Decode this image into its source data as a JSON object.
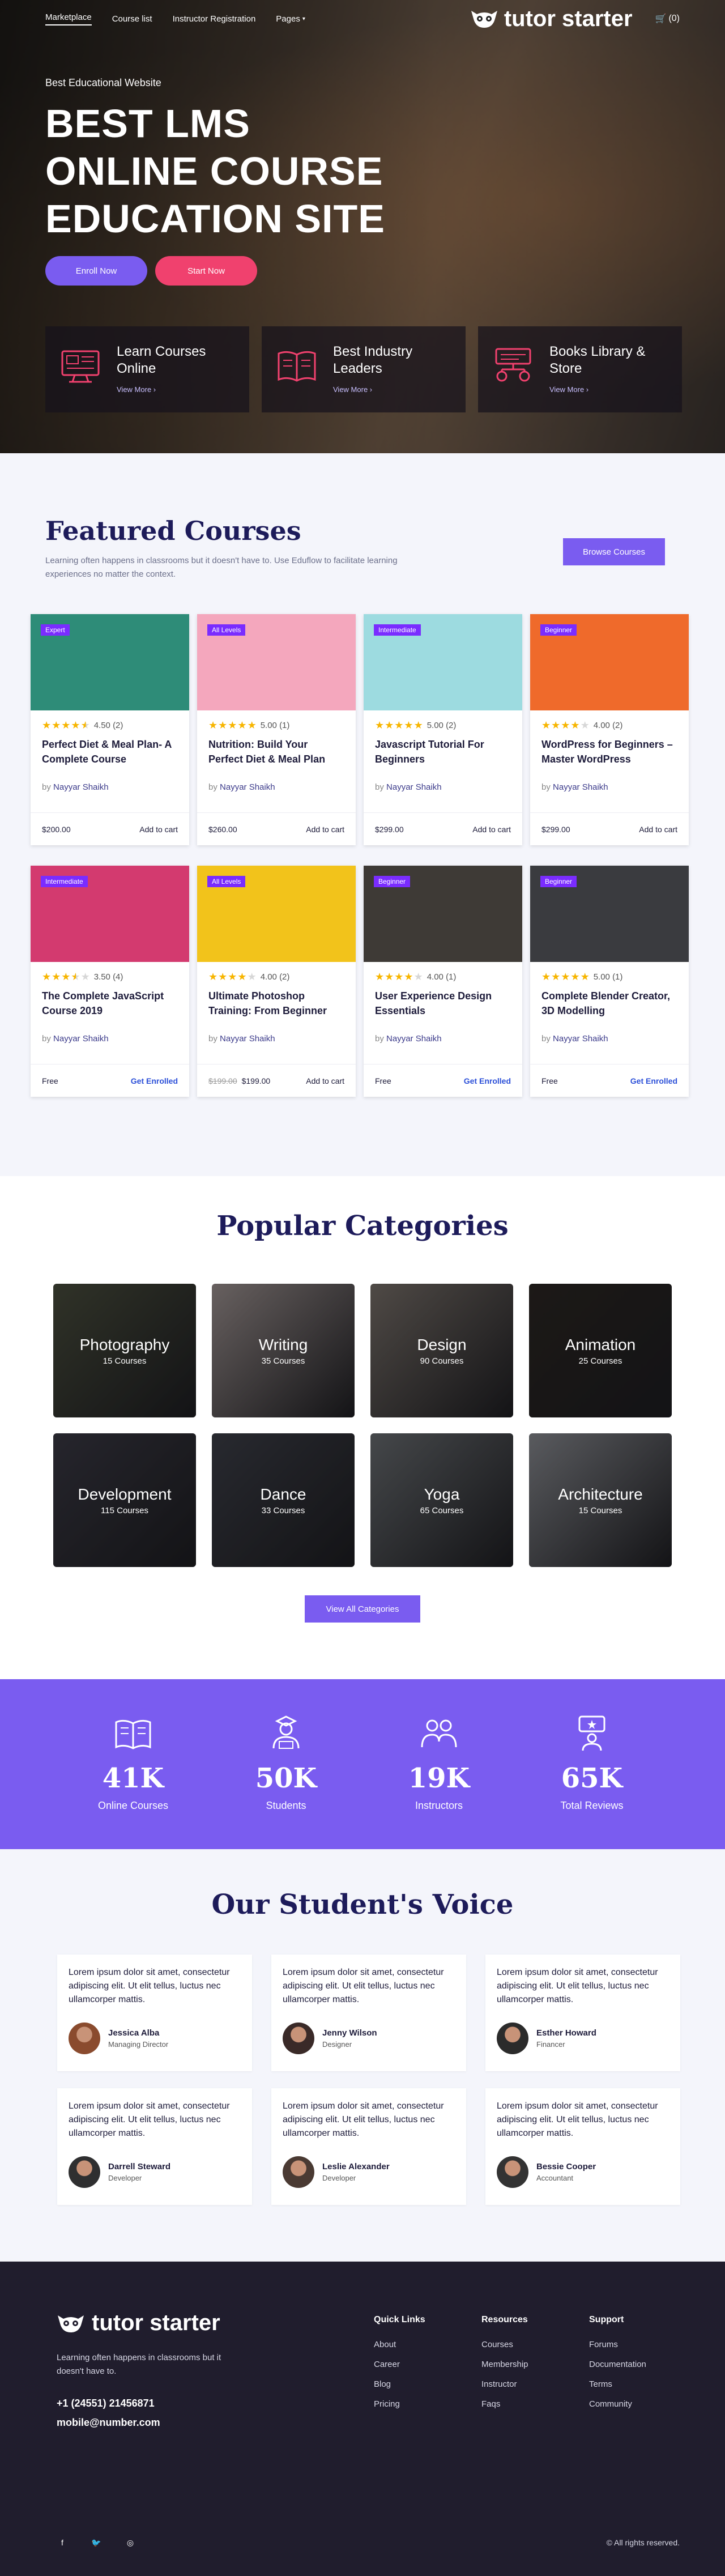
{
  "nav": {
    "links": [
      "Marketplace",
      "Course list",
      "Instructor Registration",
      "Pages"
    ],
    "brand": "tutor starter",
    "cart_count": "(0)"
  },
  "hero": {
    "subtitle": "Best Educational Website",
    "title_lines": [
      "BEST LMS",
      "ONLINE COURSE",
      "EDUCATION SITE"
    ],
    "enroll": "Enroll Now",
    "start": "Start Now",
    "features": [
      {
        "title": "Learn Courses Online",
        "more": "View More ›",
        "icon": "monitor-icon"
      },
      {
        "title": "Best Industry Leaders",
        "more": "View More ›",
        "icon": "book-icon"
      },
      {
        "title": "Books Library & Store",
        "more": "View More ›",
        "icon": "library-icon"
      }
    ]
  },
  "featured": {
    "title": "Featured Courses",
    "desc": "Learning often happens in classrooms but it doesn't have to. Use Eduflow to facilitate learning experiences no matter the context.",
    "browse": "Browse Courses",
    "courses": [
      {
        "level": "Expert",
        "stars": 4.5,
        "rating": "4.50 (2)",
        "title": "Perfect Diet & Meal Plan- A Complete Course",
        "by": "by",
        "author": "Nayyar Shaikh",
        "price": "$200.00",
        "old_price": "",
        "cta": "Add to cart",
        "color": "#2e8c78"
      },
      {
        "level": "All Levels",
        "stars": 5,
        "rating": "5.00 (1)",
        "title": "Nutrition: Build Your Perfect Diet & Meal Plan",
        "by": "by",
        "author": "Nayyar Shaikh",
        "price": "$260.00",
        "old_price": "",
        "cta": "Add to cart",
        "color": "#f4a7bd"
      },
      {
        "level": "Intermediate",
        "stars": 5,
        "rating": "5.00 (2)",
        "title": "Javascript Tutorial For Beginners",
        "by": "by",
        "author": "Nayyar Shaikh",
        "price": "$299.00",
        "old_price": "",
        "cta": "Add to cart",
        "color": "#9ddbe0"
      },
      {
        "level": "Beginner",
        "stars": 4,
        "rating": "4.00 (2)",
        "title": "WordPress for Beginners – Master WordPress",
        "by": "by",
        "author": "Nayyar Shaikh",
        "price": "$299.00",
        "old_price": "",
        "cta": "Add to cart",
        "color": "#ef6a2b"
      },
      {
        "level": "Intermediate",
        "stars": 3.5,
        "rating": "3.50 (4)",
        "title": "The Complete JavaScript Course 2019",
        "by": "by",
        "author": "Nayyar Shaikh",
        "price": "Free",
        "old_price": "",
        "cta": "Get Enrolled",
        "color": "#d33a6f"
      },
      {
        "level": "All Levels",
        "stars": 4,
        "rating": "4.00 (2)",
        "title": "Ultimate Photoshop Training: From Beginner",
        "by": "by",
        "author": "Nayyar Shaikh",
        "price": "$199.00",
        "old_price": "$199.00",
        "cta": "Add to cart",
        "color": "#f2c31b"
      },
      {
        "level": "Beginner",
        "stars": 4,
        "rating": "4.00 (1)",
        "title": "User Experience Design Essentials",
        "by": "by",
        "author": "Nayyar Shaikh",
        "price": "Free",
        "old_price": "",
        "cta": "Get Enrolled",
        "color": "#3e3a36"
      },
      {
        "level": "Beginner",
        "stars": 5,
        "rating": "5.00 (1)",
        "title": "Complete Blender Creator, 3D Modelling",
        "by": "by",
        "author": "Nayyar Shaikh",
        "price": "Free",
        "old_price": "",
        "cta": "Get Enrolled",
        "color": "#3a3b3f"
      }
    ]
  },
  "popular": {
    "title": "Popular Categories",
    "categories": [
      {
        "name": "Photography",
        "count": "15 Courses",
        "color": "#4a4e3e"
      },
      {
        "name": "Writing",
        "count": "35 Courses",
        "color": "#a09594"
      },
      {
        "name": "Design",
        "count": "90 Courses",
        "color": "#7a726c"
      },
      {
        "name": "Animation",
        "count": "25 Courses",
        "color": "#2c2724"
      },
      {
        "name": "Development",
        "count": "115 Courses",
        "color": "#3b3a45"
      },
      {
        "name": "Dance",
        "count": "33 Courses",
        "color": "#3e4049"
      },
      {
        "name": "Yoga",
        "count": "65 Courses",
        "color": "#6b6f73"
      },
      {
        "name": "Architecture",
        "count": "15 Courses",
        "color": "#8a8c92"
      }
    ],
    "view_all": "View All Categories"
  },
  "stats": [
    {
      "num": "41K",
      "label": "Online Courses",
      "icon": "book-open-icon"
    },
    {
      "num": "50K",
      "label": "Students",
      "icon": "student-icon"
    },
    {
      "num": "19K",
      "label": "Instructors",
      "icon": "instructors-icon"
    },
    {
      "num": "65K",
      "label": "Total Reviews",
      "icon": "reviews-icon"
    }
  ],
  "voice": {
    "title": "Our Student's Voice",
    "quote": "Lorem ipsum dolor sit amet, consectetur adipiscing elit. Ut elit tellus, luctus nec ullamcorper mattis.",
    "people": [
      {
        "name": "Jessica Alba",
        "role": "Managing Director",
        "color": "#8a4b2e"
      },
      {
        "name": "Jenny Wilson",
        "role": "Designer",
        "color": "#3a2a28"
      },
      {
        "name": "Esther Howard",
        "role": "Financer",
        "color": "#2b2b2b"
      },
      {
        "name": "Darrell Steward",
        "role": "Developer",
        "color": "#2f2f30"
      },
      {
        "name": "Leslie Alexander",
        "role": "Developer",
        "color": "#4a3a33"
      },
      {
        "name": "Bessie Cooper",
        "role": "Accountant",
        "color": "#333"
      }
    ]
  },
  "footer": {
    "brand": "tutor starter",
    "tagline": "Learning often happens in classrooms but it doesn't have to.",
    "phone": "+1 (24551) 21456871",
    "email": "mobile@number.com",
    "cols": [
      {
        "title": "Quick Links",
        "links": [
          "About",
          "Career",
          "Blog",
          "Pricing"
        ]
      },
      {
        "title": "Resources",
        "links": [
          "Courses",
          "Membership",
          "Instructor",
          "Faqs"
        ]
      },
      {
        "title": "Support",
        "links": [
          "Forums",
          "Documentation",
          "Terms",
          "Community"
        ]
      }
    ],
    "copyright": "© All rights reserved."
  }
}
